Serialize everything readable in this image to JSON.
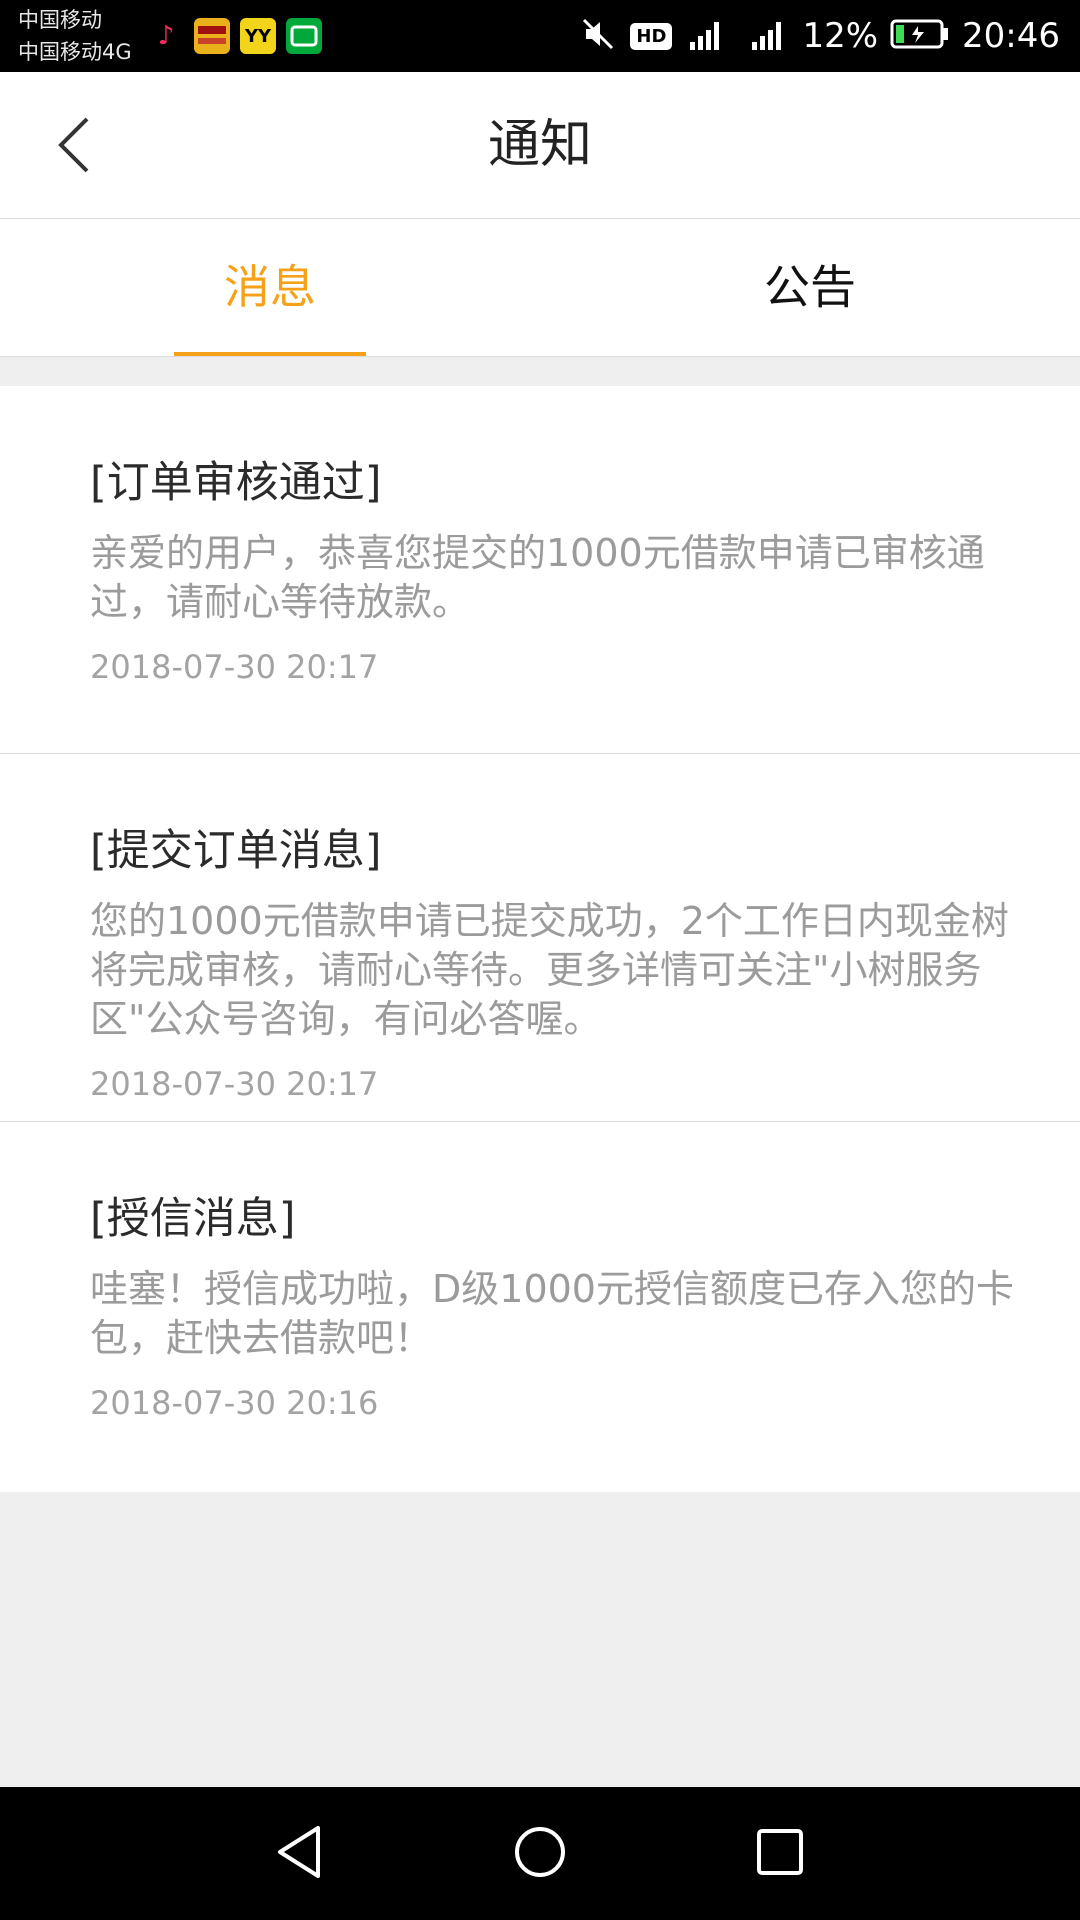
{
  "status_bar": {
    "carrier_1": "中国移动",
    "carrier_2": "中国移动4G",
    "battery": "12%",
    "time": "20:46",
    "hd": "HD",
    "apps": [
      "tiktok-icon",
      "news-app-icon",
      "yy-app-icon",
      "iqiyi-app-icon"
    ],
    "yy_label": "YY"
  },
  "header": {
    "title": "通知",
    "back_icon": "chevron-left-icon"
  },
  "tabs": [
    {
      "label": "消息",
      "active": true
    },
    {
      "label": "公告",
      "active": false
    }
  ],
  "messages": [
    {
      "title": "[订单审核通过]",
      "body": "亲爱的用户，恭喜您提交的1000元借款申请已审核通过，请耐心等待放款。",
      "time": "2018-07-30 20:17"
    },
    {
      "title": "[提交订单消息]",
      "body": "您的1000元借款申请已提交成功，2个工作日内现金树将完成审核，请耐心等待。更多详情可关注\"小树服务区\"公众号咨询，有问必答喔。",
      "time": "2018-07-30 20:17"
    },
    {
      "title": "[授信消息]",
      "body": "哇塞！授信成功啦，D级1000元授信额度已存入您的卡包，赶快去借款吧！",
      "time": "2018-07-30 20:16"
    }
  ],
  "nav": {
    "back": "nav-back-icon",
    "home": "nav-home-icon",
    "recents": "nav-recents-icon"
  },
  "colors": {
    "accent": "#f5a21a",
    "title_text": "#2b2b2b",
    "body_text": "#9b9b9b",
    "background": "#efefef"
  }
}
